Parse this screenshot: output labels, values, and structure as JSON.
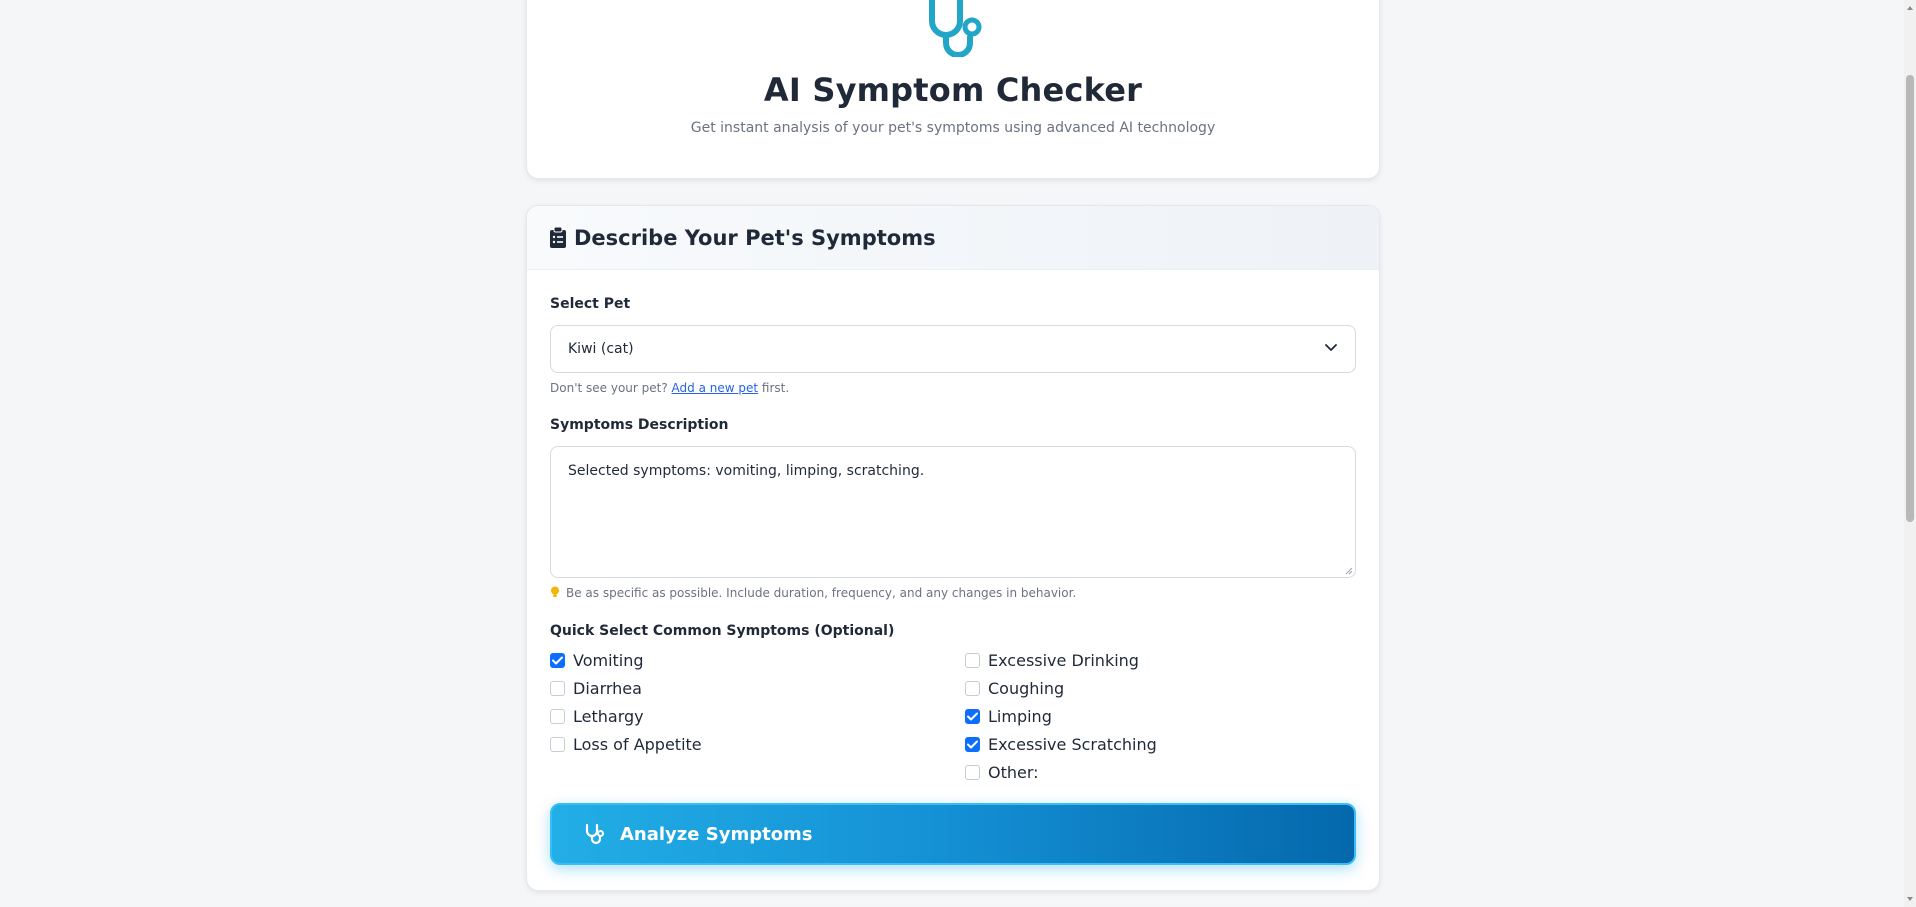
{
  "header": {
    "title": "AI Symptom Checker",
    "subtitle": "Get instant analysis of your pet's symptoms using advanced AI technology",
    "icon": "stethoscope-icon",
    "accent": "#22a6c7"
  },
  "form": {
    "card_title": "Describe Your Pet's Symptoms",
    "card_icon": "clipboard-list-icon",
    "select_pet": {
      "label": "Select Pet",
      "value": "Kiwi (cat)",
      "hint_prefix": "Don't see your pet?",
      "hint_link": "Add a new pet",
      "hint_suffix": "first."
    },
    "symptoms": {
      "label": "Symptoms Description",
      "value": "Selected symptoms: vomiting, limping, scratching.",
      "hint": "Be as specific as possible. Include duration, frequency, and any changes in behavior.",
      "hint_icon": "lightbulb-icon"
    },
    "quick_select": {
      "label": "Quick Select Common Symptoms (Optional)",
      "left": [
        {
          "label": "Vomiting",
          "checked": true
        },
        {
          "label": "Diarrhea",
          "checked": false
        },
        {
          "label": "Lethargy",
          "checked": false
        },
        {
          "label": "Loss of Appetite",
          "checked": false
        }
      ],
      "right": [
        {
          "label": "Excessive Drinking",
          "checked": false
        },
        {
          "label": "Coughing",
          "checked": false
        },
        {
          "label": "Limping",
          "checked": true
        },
        {
          "label": "Excessive Scratching",
          "checked": true
        },
        {
          "label": "Other:",
          "checked": false
        }
      ]
    },
    "analyze_button": "Analyze Symptoms",
    "check_color": "#0d6efd"
  }
}
